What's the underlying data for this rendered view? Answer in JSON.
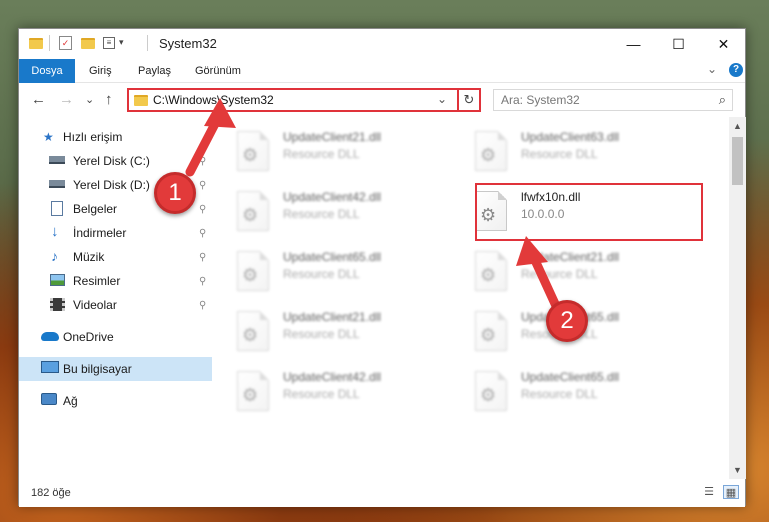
{
  "window": {
    "title": "System32",
    "minimize": "—",
    "maximize": "☐",
    "close": "✕"
  },
  "ribbon": {
    "tabs": [
      "Dosya",
      "Giriş",
      "Paylaş",
      "Görünüm"
    ],
    "collapse": "⌄",
    "help": "?"
  },
  "nav": {
    "back": "←",
    "forward": "→",
    "recent": "⌄",
    "up": "↑",
    "address": "C:\\Windows\\System32",
    "address_dropdown": "⌄",
    "refresh": "↻",
    "search_placeholder": "Ara: System32",
    "search_icon": "⌕"
  },
  "sidebar": {
    "items": [
      {
        "label": "Hızlı erişim",
        "icon": "star-icon"
      },
      {
        "label": "Yerel Disk (C:)",
        "icon": "drive-icon",
        "pinned": true
      },
      {
        "label": "Yerel Disk (D:)",
        "icon": "drive-icon",
        "pinned": true
      },
      {
        "label": "Belgeler",
        "icon": "document-icon",
        "pinned": true
      },
      {
        "label": "İndirmeler",
        "icon": "download-icon",
        "pinned": true
      },
      {
        "label": "Müzik",
        "icon": "music-icon",
        "pinned": true
      },
      {
        "label": "Resimler",
        "icon": "picture-icon",
        "pinned": true
      },
      {
        "label": "Videolar",
        "icon": "video-icon",
        "pinned": true
      },
      {
        "label": "OneDrive",
        "icon": "cloud-icon"
      },
      {
        "label": "Bu bilgisayar",
        "icon": "computer-icon",
        "selected": true
      },
      {
        "label": "Ağ",
        "icon": "network-icon"
      }
    ],
    "pin_glyph": "📌"
  },
  "files": {
    "left": [
      {
        "name": "UpdateClient21.dll",
        "desc": "Resource DLL"
      },
      {
        "name": "UpdateClient42.dll",
        "desc": "Resource DLL"
      },
      {
        "name": "UpdateClient65.dll",
        "desc": "Resource DLL"
      },
      {
        "name": "UpdateClient21.dll",
        "desc": "Resource DLL"
      },
      {
        "name": "UpdateClient42.dll",
        "desc": "Resource DLL"
      }
    ],
    "right": [
      {
        "name": "UpdateClient63.dll",
        "desc": "Resource DLL"
      },
      {
        "name": "lfwfx10n.dll",
        "desc": "10.0.0.0",
        "highlighted": true
      },
      {
        "name": "UpdateClient21.dll",
        "desc": "Resource DLL"
      },
      {
        "name": "UpdateClient65.dll",
        "desc": "Resource DLL"
      },
      {
        "name": "UpdateClient65.dll",
        "desc": "Resource DLL"
      }
    ]
  },
  "status": {
    "count": "182 öğe"
  },
  "annotations": {
    "step1": "1",
    "step2": "2"
  },
  "colors": {
    "accent": "#1979ca",
    "highlight": "#e0323a",
    "selected": "#cce4f7"
  }
}
